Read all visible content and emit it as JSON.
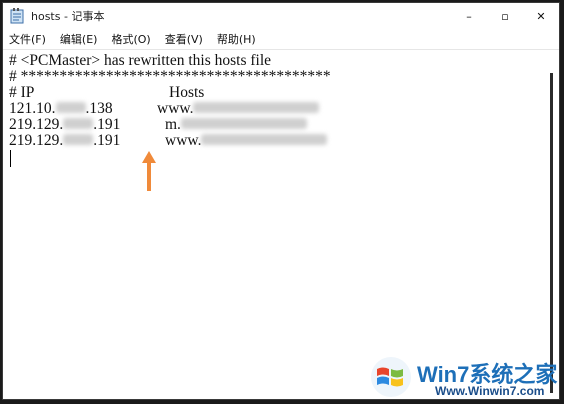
{
  "window": {
    "title": "hosts - 记事本",
    "controls": {
      "minimize": "–",
      "maximize": "▫",
      "close": "✕"
    }
  },
  "menu": [
    {
      "label": "文件(F)"
    },
    {
      "label": "编辑(E)"
    },
    {
      "label": "格式(O)"
    },
    {
      "label": "查看(V)"
    },
    {
      "label": "帮助(H)"
    }
  ],
  "editor": {
    "line1": "# <PCMaster> has rewritten this hosts file",
    "line2": "# ****************************************",
    "header": {
      "ip": "# IP",
      "hosts": "Hosts"
    },
    "rows": [
      {
        "ip_start": "121.10.",
        "ip_end": ".138",
        "host_start": "www."
      },
      {
        "ip_start": "219.129.",
        "ip_end": ".191",
        "host_start": "m."
      },
      {
        "ip_start": "219.129.",
        "ip_end": ".191",
        "host_start": "www."
      }
    ]
  },
  "colors": {
    "arrow": "#f08a3a",
    "watermark_blue": "#1d6fb8"
  },
  "watermark": {
    "title": "Win7系统之家",
    "url": "Www.Winwin7.com"
  }
}
